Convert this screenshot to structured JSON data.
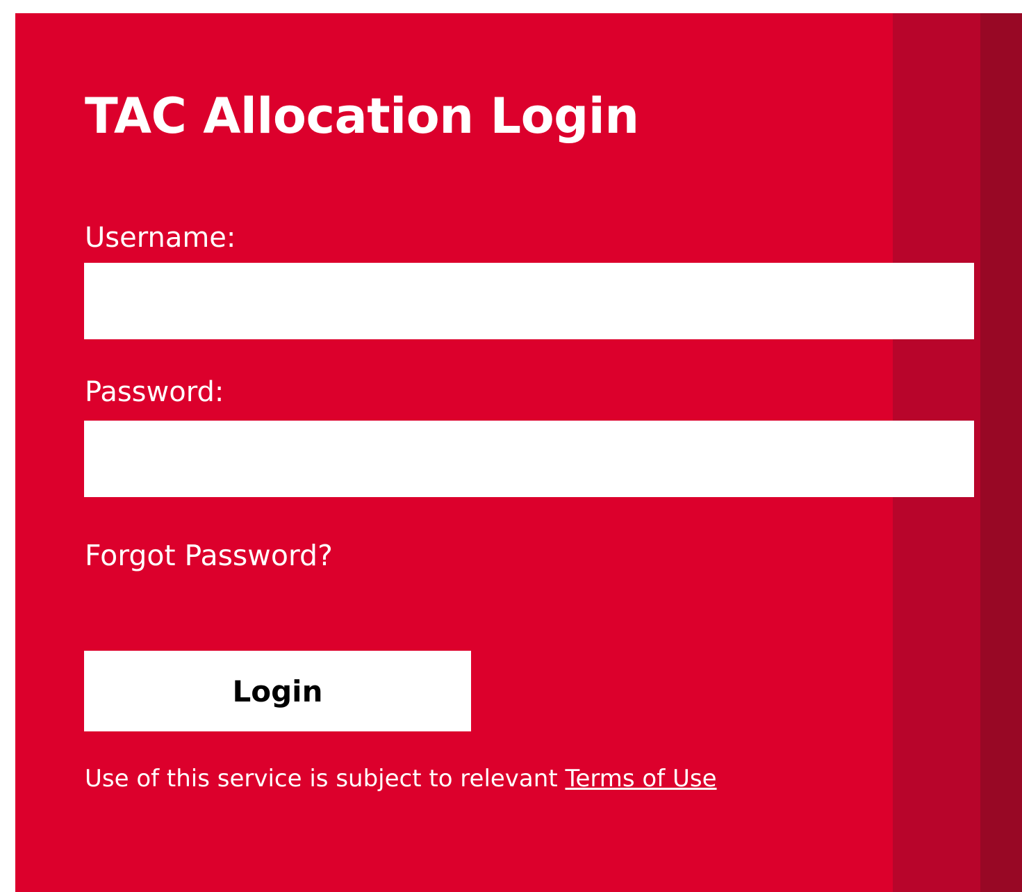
{
  "login": {
    "title": "TAC Allocation Login",
    "username_label": "Username:",
    "username_value": "",
    "password_label": "Password:",
    "password_value": "",
    "forgot_password": "Forgot Password?",
    "login_button": "Login",
    "terms_prefix": "Use of this service is subject to relevant ",
    "terms_link": "Terms of Use"
  },
  "colors": {
    "panel": "#dc002c",
    "stripe_1": "#b8052b",
    "stripe_2": "#980825",
    "text": "#ffffff",
    "field_bg": "#ffffff",
    "button_text": "#000000"
  }
}
